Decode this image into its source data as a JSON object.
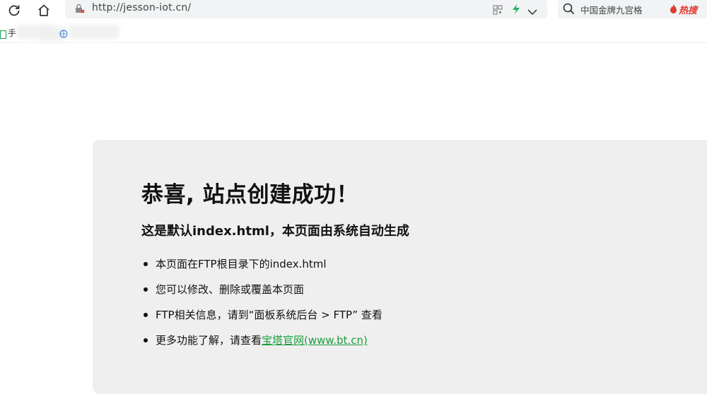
{
  "browser": {
    "url": "http://jesson-iot.cn/",
    "search_text": "中国金牌九宫格",
    "hot_label": "热搜",
    "bookmark_first_label": "手"
  },
  "page": {
    "title": "恭喜, 站点创建成功！",
    "subtitle": "这是默认index.html，本页面由系统自动生成",
    "items": [
      "本页面在FTP根目录下的index.html",
      "您可以修改、删除或覆盖本页面",
      "FTP相关信息，请到“面板系统后台 > FTP” 查看"
    ],
    "last_item_prefix": "更多功能了解，请查看",
    "link_text": "宝塔官网(www.bt.cn)"
  },
  "colors": {
    "panel_bg": "#efefef",
    "link": "#1a9d3c",
    "hot": "#e03a2e"
  },
  "icons": [
    "reload-icon",
    "home-icon",
    "not-secure-icon",
    "qr-code-icon",
    "bolt-icon",
    "chevron-down-icon",
    "search-icon",
    "fire-icon",
    "bookmark-page-icon",
    "globe-icon"
  ]
}
